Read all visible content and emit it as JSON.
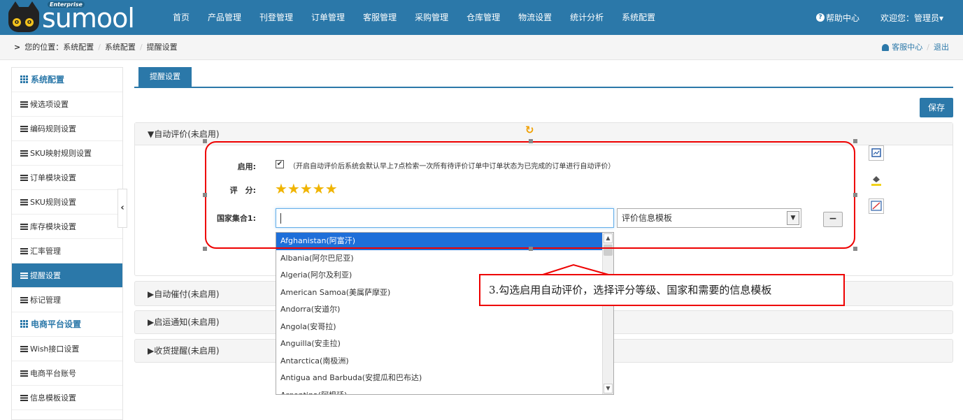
{
  "app": {
    "brand": "sumool",
    "edition": "Enterprise",
    "accent_color": "#2b78a9"
  },
  "nav": {
    "items": [
      "首页",
      "产品管理",
      "刊登管理",
      "订单管理",
      "客服管理",
      "采购管理",
      "仓库管理",
      "物流设置",
      "统计分析",
      "系统配置"
    ],
    "help": "帮助中心",
    "welcome": "欢迎您：管理员"
  },
  "breadcrumb": {
    "prefix": "您的位置：系统配置",
    "level2": "系统配置",
    "level3": "提醒设置",
    "service": "客服中心",
    "logout": "退出"
  },
  "sidebar": {
    "items": [
      {
        "label": "系统配置",
        "type": "head"
      },
      {
        "label": "候选项设置",
        "type": "item"
      },
      {
        "label": "编码规则设置",
        "type": "item"
      },
      {
        "label": "SKU映射规则设置",
        "type": "item"
      },
      {
        "label": "订单模块设置",
        "type": "item"
      },
      {
        "label": "SKU规则设置",
        "type": "item"
      },
      {
        "label": "库存模块设置",
        "type": "item"
      },
      {
        "label": "汇率管理",
        "type": "item"
      },
      {
        "label": "提醒设置",
        "type": "active"
      },
      {
        "label": "标记管理",
        "type": "item"
      },
      {
        "label": "电商平台设置",
        "type": "head"
      },
      {
        "label": "Wish接口设置",
        "type": "item"
      },
      {
        "label": "电商平台账号",
        "type": "item"
      },
      {
        "label": "信息模板设置",
        "type": "item"
      }
    ]
  },
  "tab": {
    "label": "提醒设置"
  },
  "save_label": "保存",
  "panels": {
    "auto_review": "▼自动评价(未启用)",
    "auto_urge": "▶自动催付(未启用)",
    "ship_notice": "▶启运通知(未启用)",
    "receipt_remind": "▶收货提醒(未启用)"
  },
  "form": {
    "enable_label": "启用:",
    "enable_checked": true,
    "enable_note": "（开启自动评价后系统会默认早上7点检索一次所有待评价订单中订单状态为已完成的订单进行自动评价）",
    "rating_label": "评　分:",
    "rating_value": 5,
    "rating_stars": "★★★★★",
    "country_label": "国家集合1:",
    "country_value": "",
    "template_value": "评价信息模板",
    "remove_label": "−"
  },
  "country_options": [
    "Afghanistan(阿富汗)",
    "Albania(阿尔巴尼亚)",
    "Algeria(阿尔及利亚)",
    "American Samoa(美属萨摩亚)",
    "Andorra(安道尔)",
    "Angola(安哥拉)",
    "Anguilla(安圭拉)",
    "Antarctica(南极洲)",
    "Antigua and Barbuda(安提瓜和巴布达)",
    "Argentina(阿根廷)"
  ],
  "callout": "3.勾选启用自动评价，选择评分等级、国家和需要的信息模板"
}
